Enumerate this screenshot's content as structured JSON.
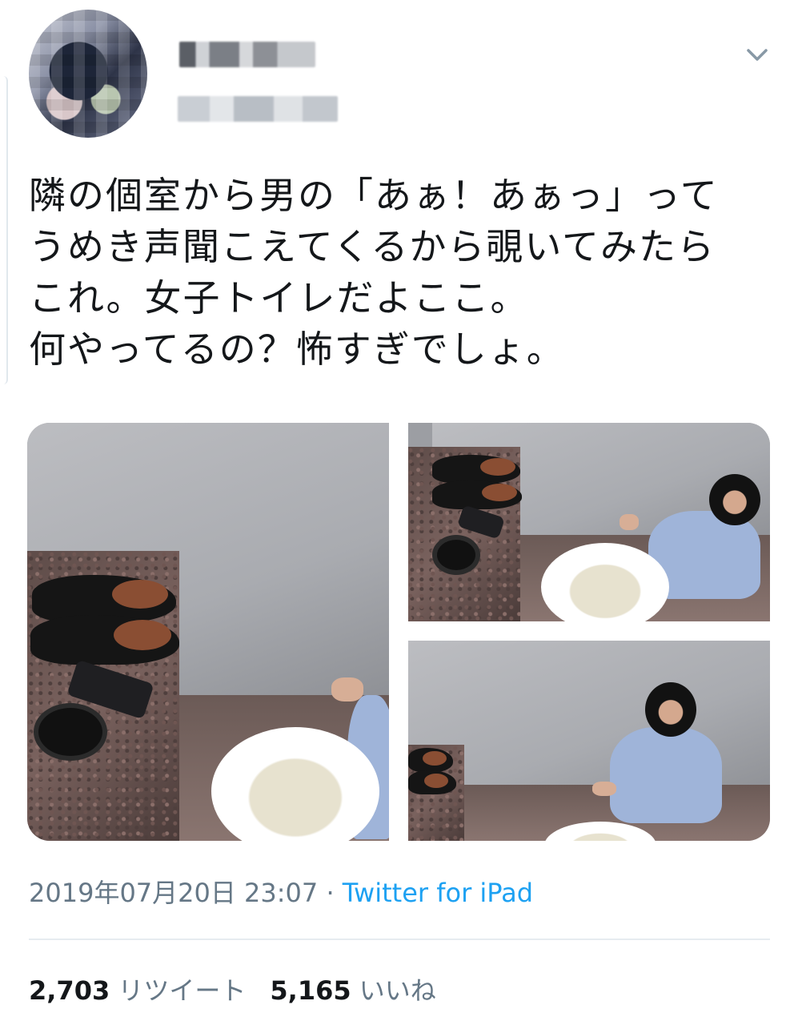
{
  "tweet": {
    "icons": {
      "menu": "chevron-down-icon"
    },
    "text_lines": [
      "隣の個室から男の「あぁ！あぁっ」って",
      "うめき声聞こえてくるから覗いてみたら",
      "これ。女子トイレだよここ。",
      "何やってるの？怖すぎでしょ。"
    ],
    "timestamp": "2019年07月20日 23:07",
    "separator": " · ",
    "source": "Twitter for iPad",
    "retweets": {
      "count": "2,703",
      "label": "リツイート"
    },
    "likes": {
      "count": "5,165",
      "label": "いいね"
    }
  },
  "colors": {
    "text": "#14171a",
    "secondary": "#657786",
    "link": "#1da1f2",
    "divider": "#e6ecf0"
  }
}
